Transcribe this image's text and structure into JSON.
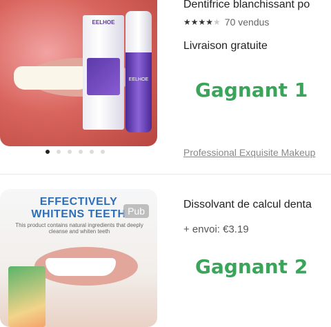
{
  "products": [
    {
      "title": "Dentifrice blanchissant po",
      "stars": 4,
      "sold": "70 vendus",
      "shipping": "Livraison gratuite",
      "store": "Professional Exquisite Makeup",
      "image": {
        "brand": "EELHOE",
        "pager_count": 6,
        "pager_active": 0
      },
      "winner_label": "Gagnant 1"
    },
    {
      "title": "Dissolvant de calcul denta",
      "shipping": "+ envoi: €3.19",
      "badge": "Pub",
      "image": {
        "headline_line1": "EFFECTIVELY",
        "headline_line2": "WHITENS TEETH",
        "subtext": "This product contains natural ingredients that deeply cleanse and whiten teeth"
      },
      "winner_label": "Gagnant 2"
    }
  ],
  "colors": {
    "winner": "#3aa55a",
    "ad_headline": "#2d6fb7",
    "brand_purple": "#5b3aa8"
  }
}
